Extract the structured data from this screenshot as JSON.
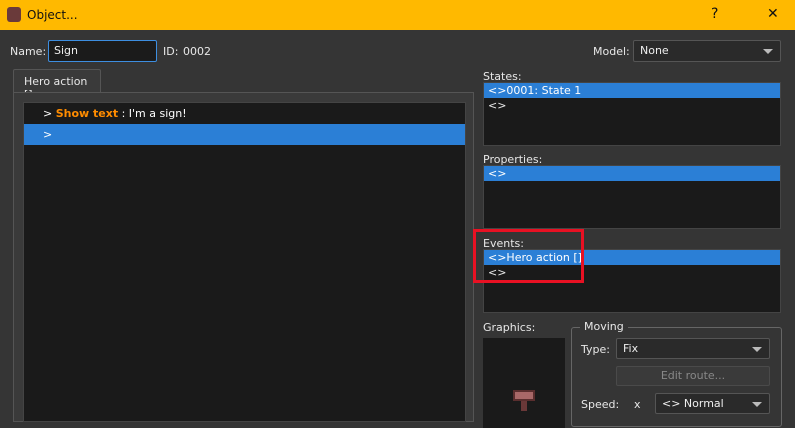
{
  "window": {
    "title": "Object...",
    "help": "?",
    "close": "✕"
  },
  "header": {
    "name_label": "Name:",
    "name_value": "Sign",
    "id_label": "ID:",
    "id_value": "0002",
    "model_label": "Model:",
    "model_value": "None"
  },
  "tab": {
    "label": "Hero action []"
  },
  "commands": [
    {
      "prefix": ">",
      "command": "Show text",
      "rest": " : I'm a sign!"
    },
    {
      "prefix": ">",
      "command": "",
      "rest": ""
    }
  ],
  "states": {
    "label": "States:",
    "items": [
      "<>0001: State 1",
      "<>"
    ]
  },
  "properties": {
    "label": "Properties:",
    "items": [
      "<>"
    ]
  },
  "events": {
    "label": "Events:",
    "items": [
      "<>Hero action []",
      "<>"
    ]
  },
  "graphics": {
    "label": "Graphics:"
  },
  "moving": {
    "title": "Moving",
    "type_label": "Type:",
    "type_value": "Fix",
    "edit_route": "Edit route...",
    "speed_label": "Speed:",
    "speed_x": "x",
    "speed_value": "<> Normal"
  },
  "colors": {
    "titlebar": "#ffb900",
    "selection": "#2b7fd6",
    "command": "#ff8c00",
    "highlight": "#e81123"
  }
}
